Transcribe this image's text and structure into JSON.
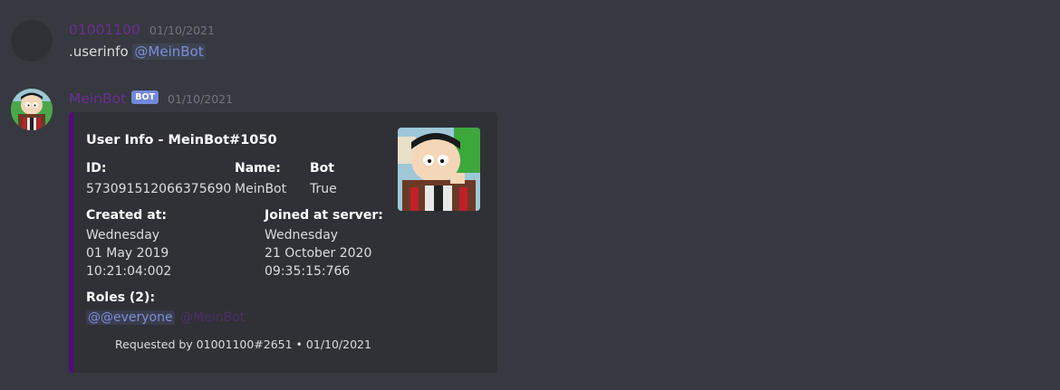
{
  "colors": {
    "background": "#36393f",
    "embed_bg": "#2f3136",
    "embed_accent": "#520b7c",
    "username_purple": "#6b2e91",
    "mention_blue": "#7b8fd6",
    "bot_tag": "#7289da"
  },
  "message1": {
    "username": "01001100",
    "timestamp": "01/10/2021",
    "text": ".userinfo",
    "mention": "@MeinBot"
  },
  "message2": {
    "username": "MeinBot",
    "bot_tag": "BOT",
    "timestamp": "01/10/2021",
    "embed": {
      "title": "User Info - MeinBot#1050",
      "fields": {
        "id_label": "ID:",
        "id_value": "573091512066375690",
        "name_label": "Name:",
        "name_value": "MeinBot",
        "bot_label": "Bot",
        "bot_value": "True",
        "created_label": "Created at:",
        "created_day": "Wednesday",
        "created_date": "01 May 2019",
        "created_time": "10:21:04:002",
        "joined_label": "Joined at server:",
        "joined_day": "Wednesday",
        "joined_date": "21 October 2020",
        "joined_time": "09:35:15:766",
        "roles_label": "Roles (2):",
        "role_everyone": "@@everyone",
        "role_bot": "@MeinBot"
      },
      "footer": "Requested by 01001100#2651 • 01/10/2021"
    }
  }
}
